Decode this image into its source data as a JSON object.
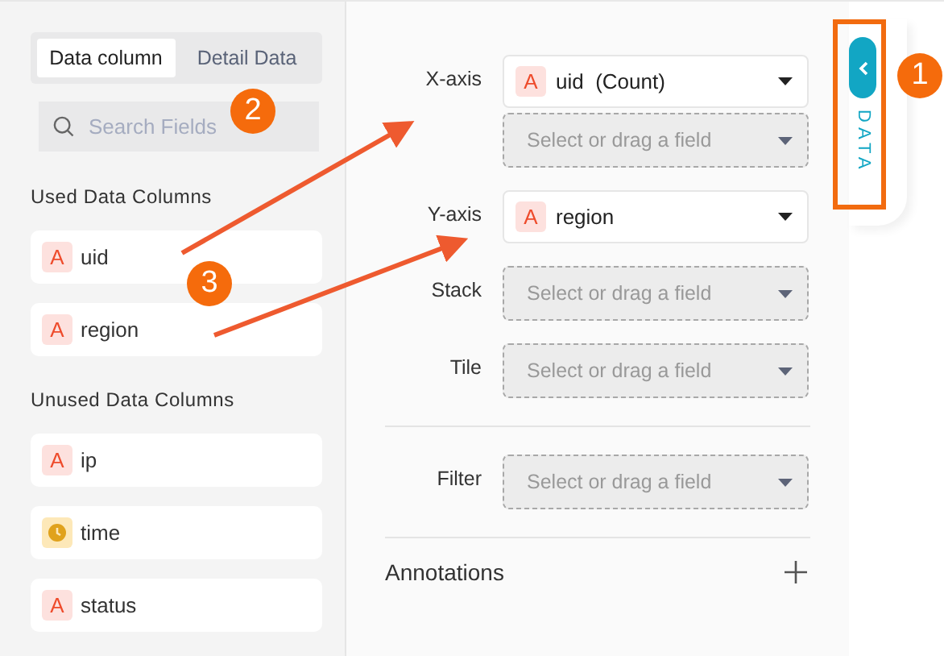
{
  "tabs": [
    {
      "label": "Data column",
      "selected": true
    },
    {
      "label": "Detail Data",
      "selected": false
    }
  ],
  "search": {
    "placeholder": "Search Fields"
  },
  "used_columns": {
    "title": "Used Data Columns",
    "items": [
      {
        "name": "uid",
        "kind": "text",
        "glyph": "A"
      },
      {
        "name": "region",
        "kind": "text",
        "glyph": "A"
      }
    ]
  },
  "unused_columns": {
    "title": "Unused Data Columns",
    "items": [
      {
        "name": "ip",
        "kind": "text",
        "glyph": "A"
      },
      {
        "name": "time",
        "kind": "time"
      },
      {
        "name": "status",
        "kind": "text",
        "glyph": "A"
      }
    ]
  },
  "sections": [
    {
      "rows": [
        {
          "label": "X-axis",
          "slots": [
            {
              "kind": "filled",
              "glyph": "A",
              "value": "uid  (Count)"
            },
            {
              "kind": "empty",
              "placeholder": "Select or drag a field"
            }
          ]
        },
        {
          "label": "Y-axis",
          "slots": [
            {
              "kind": "filled",
              "glyph": "A",
              "value": "region"
            }
          ]
        },
        {
          "label": "Stack",
          "slots": [
            {
              "kind": "empty",
              "placeholder": "Select or drag a field"
            }
          ]
        },
        {
          "label": "Tile",
          "slots": [
            {
              "kind": "empty",
              "placeholder": "Select or drag a field"
            }
          ]
        }
      ]
    },
    {
      "rows": [
        {
          "label": "Filter",
          "slots": [
            {
              "kind": "empty",
              "placeholder": "Select or drag a field"
            }
          ]
        }
      ]
    }
  ],
  "annotations": {
    "label": "Annotations"
  },
  "side_tab": {
    "label": "DATA"
  },
  "callouts": [
    {
      "number": "1"
    },
    {
      "number": "2"
    },
    {
      "number": "3"
    }
  ]
}
